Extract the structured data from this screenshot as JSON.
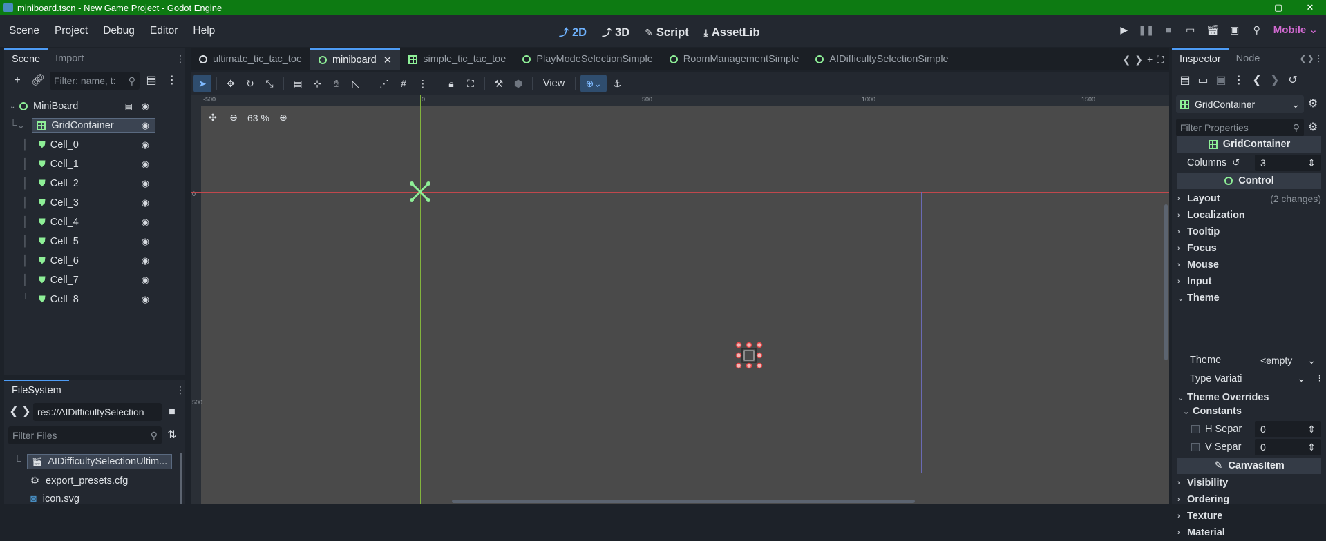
{
  "window": {
    "title": "miniboard.tscn - New Game Project - Godot Engine",
    "controls": [
      "—",
      "▢",
      "✕"
    ]
  },
  "menubar": {
    "items": [
      "Scene",
      "Project",
      "Debug",
      "Editor",
      "Help"
    ]
  },
  "workspaces": [
    {
      "label": "2D",
      "icon": "2d-icon",
      "glyph": "⤴"
    },
    {
      "label": "3D",
      "icon": "3d-icon",
      "glyph": "⤴"
    },
    {
      "label": "Script",
      "icon": "script-icon",
      "glyph": "✎"
    },
    {
      "label": "AssetLib",
      "icon": "assetlib-icon",
      "glyph": "⤓"
    }
  ],
  "run_bar": {
    "renderer": "Mobile",
    "buttons": [
      "play-icon",
      "pause-icon",
      "stop-icon",
      "remote-debug-icon",
      "play-scene-icon",
      "play-custom-icon",
      "movie-icon"
    ]
  },
  "scene_panel": {
    "tabs": [
      "Scene",
      "Import"
    ],
    "filter_placeholder": "Filter: name, t:",
    "nodes": [
      {
        "name": "MiniBoard",
        "type": "control"
      },
      {
        "name": "GridContainer",
        "type": "grid",
        "selected": true
      },
      {
        "name": "Cell_0",
        "type": "cell"
      },
      {
        "name": "Cell_1",
        "type": "cell"
      },
      {
        "name": "Cell_2",
        "type": "cell"
      },
      {
        "name": "Cell_3",
        "type": "cell"
      },
      {
        "name": "Cell_4",
        "type": "cell"
      },
      {
        "name": "Cell_5",
        "type": "cell"
      },
      {
        "name": "Cell_6",
        "type": "cell"
      },
      {
        "name": "Cell_7",
        "type": "cell"
      },
      {
        "name": "Cell_8",
        "type": "cell"
      }
    ]
  },
  "filesystem": {
    "tab": "FileSystem",
    "path": "res://AIDifficultySelection",
    "filter_placeholder": "Filter Files",
    "items": [
      "AIDifficultySelectionUltim...",
      "export_presets.cfg",
      "icon.svg"
    ]
  },
  "doc_tabs": [
    {
      "label": "ultimate_tic_tac_toe",
      "icon": "ring"
    },
    {
      "label": "miniboard",
      "icon": "ring",
      "active": true
    },
    {
      "label": "simple_tic_tac_toe",
      "icon": "grid"
    },
    {
      "label": "PlayModeSelectionSimple",
      "icon": "ring"
    },
    {
      "label": "RoomManagementSimple",
      "icon": "ring"
    },
    {
      "label": "AIDifficultySelectionSimple",
      "icon": "ring"
    }
  ],
  "viewport_toolbar": {
    "view_label": "View"
  },
  "viewport": {
    "zoom": "63 %",
    "ruler_top": [
      "-500",
      "0",
      "500",
      "1000",
      "1500"
    ],
    "ruler_left": [
      "0",
      "500"
    ]
  },
  "inspector": {
    "tabs": [
      "Inspector",
      "Node"
    ],
    "node_type": "GridContainer",
    "filter_placeholder": "Filter Properties",
    "header": "GridContainer",
    "columns_label": "Columns",
    "columns_value": "3",
    "control_header": "Control",
    "sections": [
      "Layout",
      "Localization",
      "Tooltip",
      "Focus",
      "Mouse",
      "Input",
      "Theme"
    ],
    "layout_changes": "(2 changes)",
    "theme_label": "Theme",
    "theme_value": "<empty",
    "type_variation_label": "Type Variati",
    "theme_overrides": "Theme Overrides",
    "constants": "Constants",
    "h_sep_label": "H Separ",
    "h_sep_value": "0",
    "v_sep_label": "V Separ",
    "v_sep_value": "0",
    "canvas_header": "CanvasItem",
    "canvas_sections": [
      "Visibility",
      "Ordering",
      "Texture",
      "Material"
    ]
  },
  "colors": {
    "titlebar": "#0d7a12",
    "accent": "#4e9cf5",
    "node_green": "#8eef97",
    "renderer": "#d16ad1"
  }
}
